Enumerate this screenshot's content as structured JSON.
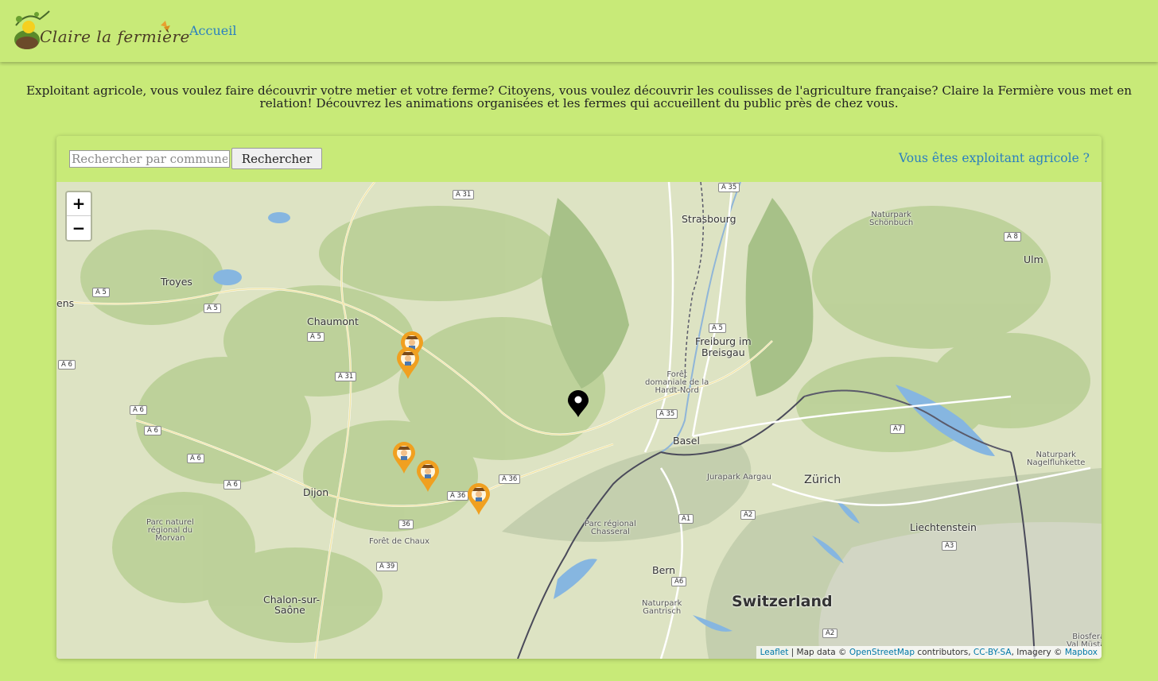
{
  "brand": {
    "logo_text": "Claire la fermière"
  },
  "nav": {
    "home_label": "Accueil"
  },
  "intro": {
    "text": "Exploitant agricole, vous voulez faire découvrir votre metier et votre ferme? Citoyens, vous voulez découvrir les coulisses de l'agriculture française? Claire la Fermière vous met en relation! Découvrez les animations organisées et les fermes qui accueillent du public près de chez vous."
  },
  "search": {
    "placeholder": "Rechercher par commune",
    "value": "",
    "button_label": "Rechercher"
  },
  "farmer_link": {
    "label": "Vous êtes exploitant agricole ?"
  },
  "map": {
    "zoom_in": "+",
    "zoom_out": "−",
    "attribution": {
      "leaflet": "Leaflet",
      "sep1": " | Map data © ",
      "osm": "OpenStreetMap",
      "sep2": " contributors, ",
      "license": "CC-BY-SA",
      "sep3": ", Imagery © ",
      "mapbox": "Mapbox"
    },
    "places": {
      "strasbourg": "Strasbourg",
      "troyes": "Troyes",
      "ulm": "Ulm",
      "chaumont": "Chaumont",
      "freiburg1": "Freiburg im",
      "freiburg2": "Breisgau",
      "basel": "Basel",
      "zurich": "Zürich",
      "liechtenstein": "Liechtenstein",
      "dijon": "Dijon",
      "bern": "Bern",
      "switzerland": "Switzerland",
      "chalon1": "Chalon-sur-",
      "chalon2": "Saône",
      "ens": "ens",
      "foret_chaux": "Forêt de Chaux",
      "jurapark": "Jurapark Aargau"
    },
    "regions": {
      "schonbuch": "Naturpark\nSchönbuch",
      "hardt": "Forêt\ndomaniale de la\nHardt-Nord",
      "morvan": "Parc naturel\nrégional du\nMorvan",
      "chasseral": "Parc régional\nChasseral",
      "gantrisch": "Naturpark\nGantrisch",
      "nagelfluh": "Naturpark\nNagelfluhkette",
      "biosfera": "Biosfera\nVal Müstair"
    },
    "roads": {
      "a31_top": "A 31",
      "a35_top": "A 35",
      "a8": "A 8",
      "a5_w": "A 5",
      "a5_w2": "A 5",
      "a5_c": "A 5",
      "a6_1": "A 6",
      "a31_c": "A 31",
      "a6_2": "A 6",
      "a6_3": "A 6",
      "a6_4": "A 6",
      "a6_5": "A 6",
      "a5_fr": "A 5",
      "a35_b": "A 35",
      "a7": "A7",
      "a36_1": "A 36",
      "a36_2": "A 36",
      "a36_3": "36",
      "a1": "A1",
      "a2": "A2",
      "a3": "A3",
      "a6_ch": "A6",
      "a39": "A 39",
      "a2_b": "A2"
    }
  }
}
